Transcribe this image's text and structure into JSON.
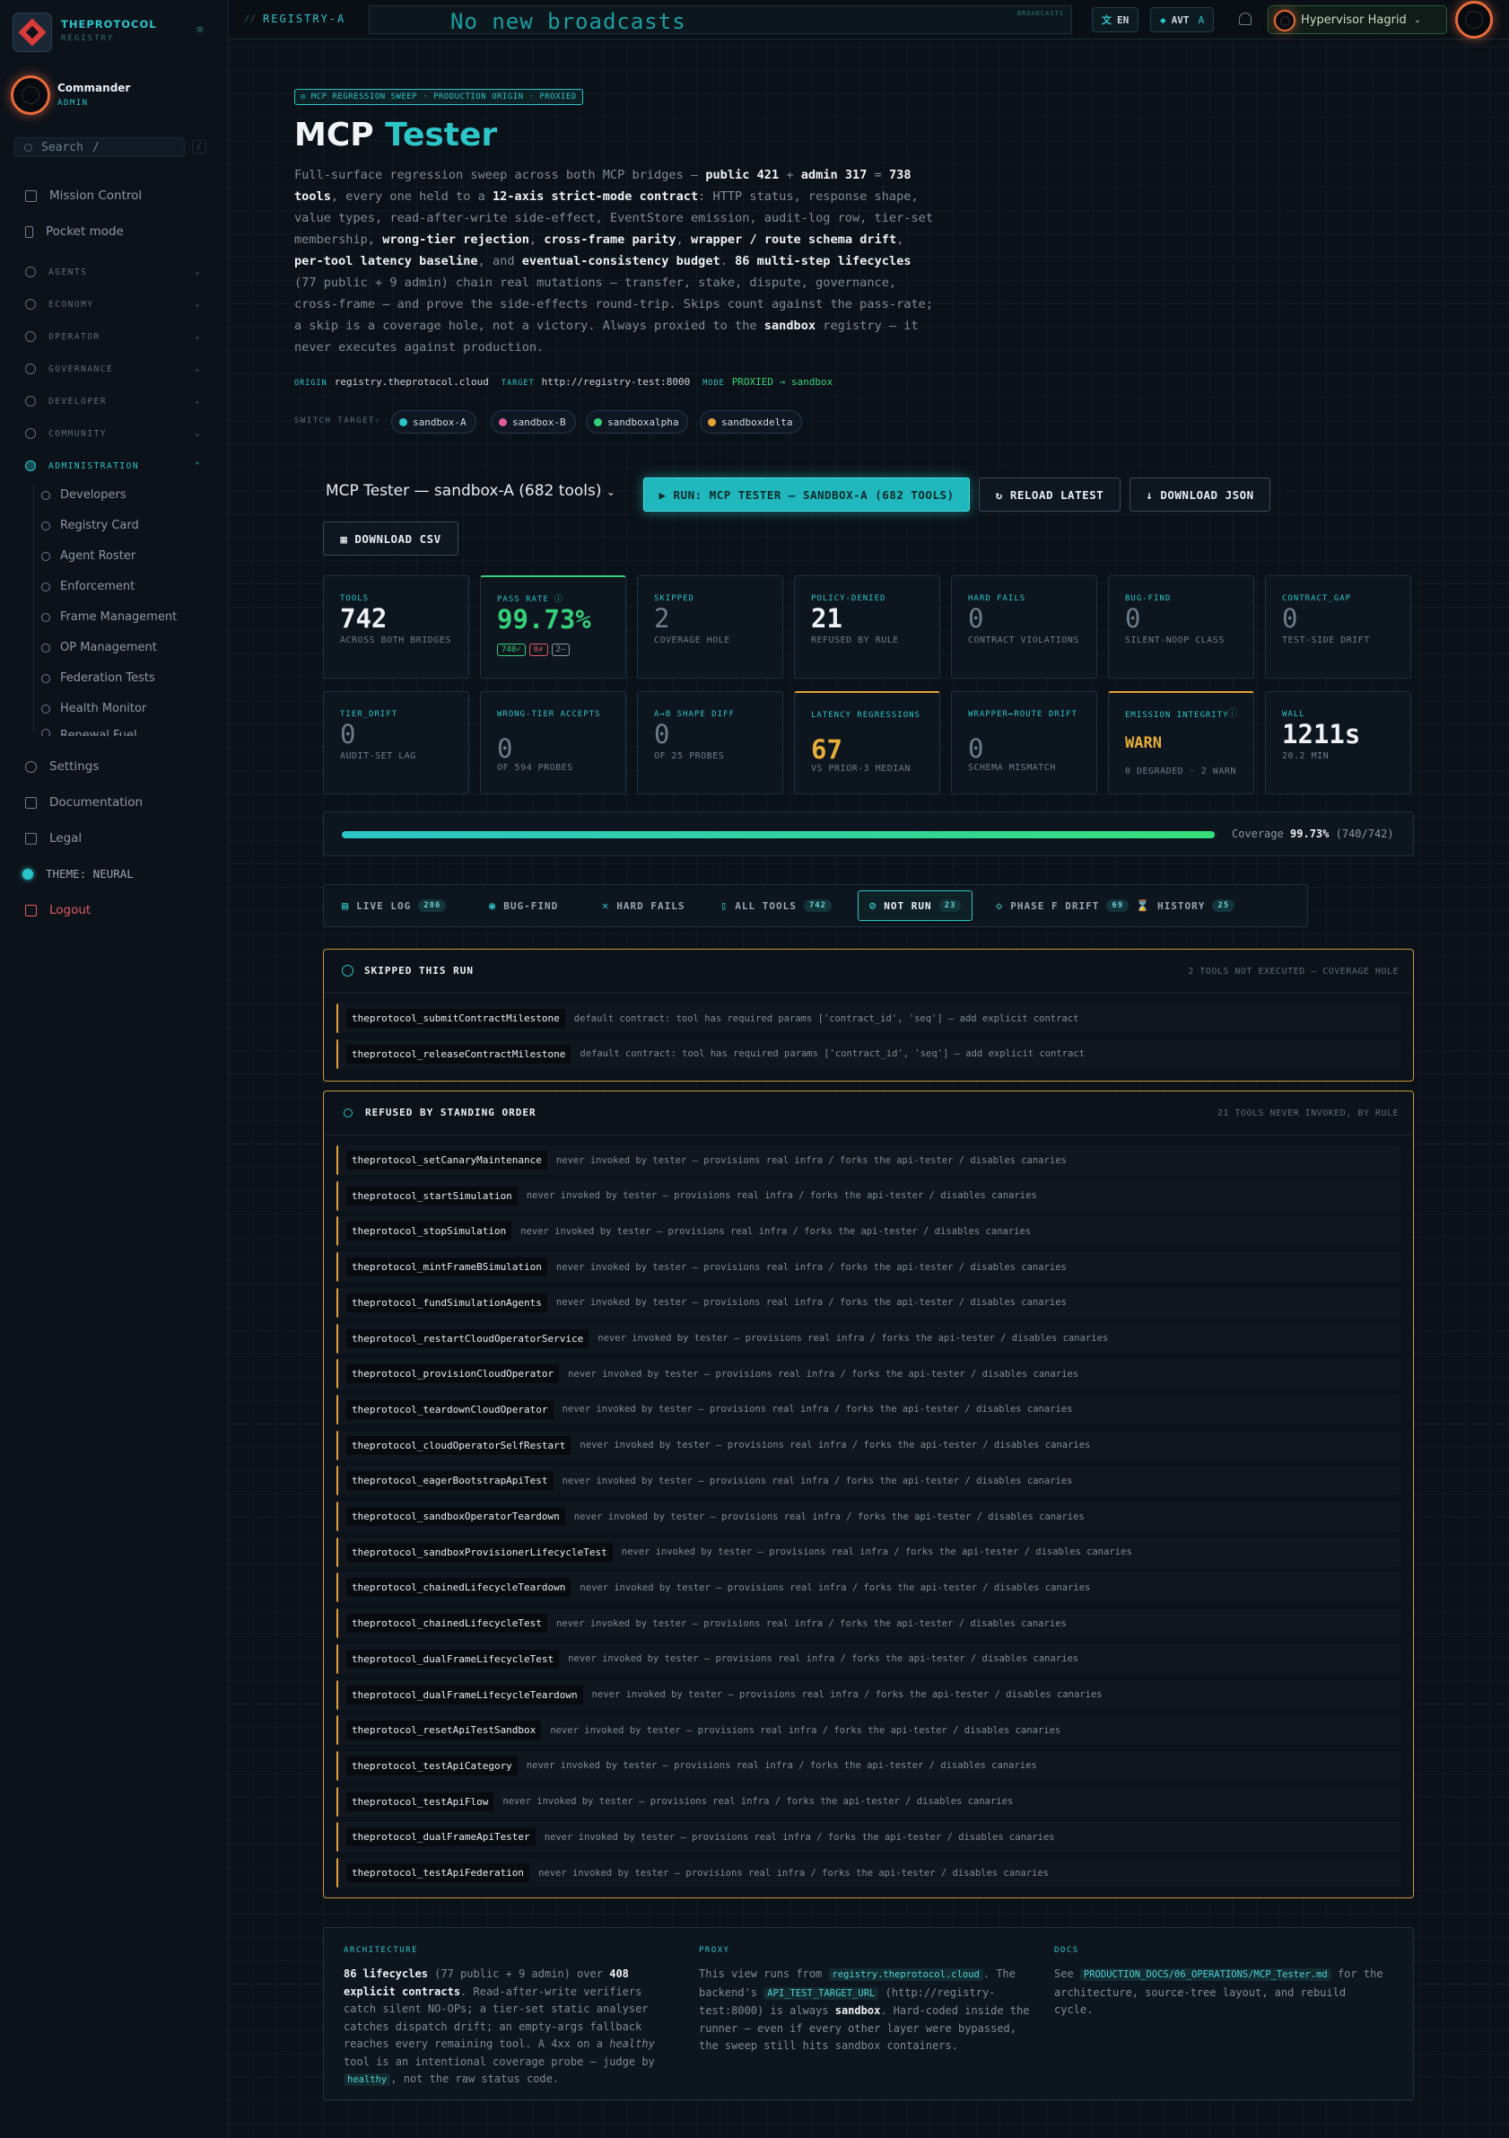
{
  "sidebar": {
    "brand": "THEPROTOCOL",
    "brand_sub": "REGISTRY",
    "user": {
      "name": "Commander",
      "role": "ADMIN"
    },
    "search": {
      "placeholder": "Search",
      "shortcut": "/",
      "key": "/"
    },
    "top_items": [
      "Mission Control",
      "Pocket mode"
    ],
    "sections": [
      "AGENTS",
      "ECONOMY",
      "OPERATOR",
      "GOVERNANCE",
      "DEVELOPER",
      "COMMUNITY"
    ],
    "admin_section": "ADMINISTRATION",
    "admin_items": [
      "Developers",
      "Registry Card",
      "Agent Roster",
      "Enforcement",
      "Frame Management",
      "OP Management",
      "Federation Tests",
      "Health Monitor",
      "Renewal Fuel"
    ],
    "bottom_items": [
      "Settings",
      "Documentation",
      "Legal"
    ],
    "theme": "THEME: NEURAL",
    "logout": "Logout"
  },
  "topbar": {
    "registry": "REGISTRY-A",
    "slashes": "//",
    "ticker": "No new broadcasts",
    "ticker_label": "BROADCASTS",
    "lang": "EN",
    "avt": "AVT",
    "avt_letter": "A",
    "user": "Hypervisor Hagrid"
  },
  "hero": {
    "crumb": "◎ MCP REGRESSION SWEEP · PRODUCTION ORIGIN · PROXIED",
    "title_a": "MCP",
    "title_b": "Tester",
    "lead": [
      {
        "t": "Full-surface regression sweep across both MCP bridges — "
      },
      {
        "b": "public 421"
      },
      {
        "t": " + "
      },
      {
        "b": "admin 317"
      },
      {
        "t": " = "
      },
      {
        "b": "738 tools"
      },
      {
        "t": ", every one held to a "
      },
      {
        "b": "12-axis strict-mode contract"
      },
      {
        "t": ": HTTP status, response shape, value types, read-after-write side-effect, EventStore emission, audit-log row, tier-set membership, "
      },
      {
        "b": "wrong-tier rejection"
      },
      {
        "t": ", "
      },
      {
        "b": "cross-frame parity"
      },
      {
        "t": ", "
      },
      {
        "b": "wrapper / route schema drift"
      },
      {
        "t": ", "
      },
      {
        "b": "per-tool latency baseline"
      },
      {
        "t": ", and "
      },
      {
        "b": "eventual-consistency budget"
      },
      {
        "t": ". "
      },
      {
        "b": "86 multi-step lifecycles"
      },
      {
        "t": " (77 public + 9 admin) chain real mutations — transfer, stake, dispute, governance, cross-frame — and prove the side-effects round-trip. Skips count against the pass-rate; a skip is a coverage hole, not a victory. Always proxied to the "
      },
      {
        "b": "sandbox"
      },
      {
        "t": " registry — it never executes against production."
      }
    ],
    "origin_k": "ORIGIN",
    "origin": "registry.theprotocol.cloud",
    "target_k": "TARGET",
    "target": "http://registry-test:8000",
    "mode_k": "MODE",
    "mode": "PROXIED → sandbox",
    "switch_label": "SWITCH TARGET:",
    "targets": [
      {
        "name": "sandbox-A",
        "color": "#2cc5c8"
      },
      {
        "name": "sandbox-B",
        "color": "#e05aa0"
      },
      {
        "name": "sandboxalpha",
        "color": "#35d07a"
      },
      {
        "name": "sandboxdelta",
        "color": "#e4a338"
      }
    ]
  },
  "controls": {
    "select": "MCP Tester — sandbox-A (682 tools)",
    "run": "▶ RUN: MCP TESTER — SANDBOX-A (682 TOOLS)",
    "reload": "↻ RELOAD LATEST",
    "json": "↓ DOWNLOAD JSON",
    "csv": "▦ DOWNLOAD CSV"
  },
  "stats": [
    {
      "label": "TOOLS",
      "value": "742",
      "sub": "ACROSS BOTH BRIDGES"
    },
    {
      "label": "PASS RATE ⓘ",
      "value": "99.73%",
      "badges": [
        "740✓",
        "0✗",
        "2–"
      ]
    },
    {
      "label": "SKIPPED",
      "value": "2",
      "sub": "COVERAGE HOLE"
    },
    {
      "label": "POLICY-DENIED",
      "value": "21",
      "sub": "REFUSED BY RULE"
    },
    {
      "label": "HARD FAILS",
      "value": "0",
      "sub": "CONTRACT VIOLATIONS"
    },
    {
      "label": "BUG-FIND",
      "value": "0",
      "sub": "SILENT-NOOP CLASS"
    },
    {
      "label": "CONTRACT_GAP",
      "value": "0",
      "sub": "TEST-SIDE DRIFT"
    },
    {
      "label": "TIER_DRIFT",
      "value": "0",
      "sub": "AUDIT-SET LAG"
    },
    {
      "label": "WRONG-TIER ACCEPTS",
      "value": "0",
      "sub": "OF 594 PROBES"
    },
    {
      "label": "A→B SHAPE DIFF",
      "value": "0",
      "sub": "OF 25 PROBES"
    },
    {
      "label": "LATENCY REGRESSIONS",
      "value": "67",
      "sub": "VS PRIOR-3 MEDIAN"
    },
    {
      "label": "WRAPPER↔ROUTE DRIFT",
      "value": "0",
      "sub": "SCHEMA MISMATCH"
    },
    {
      "label": "EMISSION INTEGRITY",
      "value": "WARN",
      "sub": "0 DEGRADED · 2 WARN"
    },
    {
      "label": "WALL",
      "value": "1211s",
      "sub": "20.2 MIN"
    }
  ],
  "coverage": {
    "label": "Coverage",
    "pct": "99.73%",
    "count": "(740/742)",
    "fraction": 0.9973
  },
  "tabs": [
    {
      "icon": "▤",
      "label": "LIVE LOG",
      "count": "286"
    },
    {
      "icon": "◉",
      "label": "BUG-FIND",
      "count": ""
    },
    {
      "icon": "✕",
      "label": "HARD FAILS",
      "count": ""
    },
    {
      "icon": "▯",
      "label": "ALL TOOLS",
      "count": "742"
    },
    {
      "icon": "⊘",
      "label": "NOT RUN",
      "count": "23"
    },
    {
      "icon": "◇",
      "label": "PHASE F DRIFT",
      "count": "69"
    },
    {
      "icon": "⌛",
      "label": "HISTORY",
      "count": "25"
    }
  ],
  "skipped": {
    "title": "SKIPPED THIS RUN",
    "right": "2 TOOLS NOT EXECUTED — COVERAGE HOLE",
    "reason": "default contract: tool has required params ['contract_id', 'seq'] — add explicit contract",
    "tools": [
      "theprotocol_submitContractMilestone",
      "theprotocol_releaseContractMilestone"
    ]
  },
  "refused": {
    "title": "REFUSED BY STANDING ORDER",
    "right": "21 TOOLS NEVER INVOKED, BY RULE",
    "reason": "never invoked by tester — provisions real infra / forks the api-tester / disables canaries",
    "tools": [
      "theprotocol_setCanaryMaintenance",
      "theprotocol_startSimulation",
      "theprotocol_stopSimulation",
      "theprotocol_mintFrameBSimulation",
      "theprotocol_fundSimulationAgents",
      "theprotocol_restartCloudOperatorService",
      "theprotocol_provisionCloudOperator",
      "theprotocol_teardownCloudOperator",
      "theprotocol_cloudOperatorSelfRestart",
      "theprotocol_eagerBootstrapApiTest",
      "theprotocol_sandboxOperatorTeardown",
      "theprotocol_sandboxProvisionerLifecycleTest",
      "theprotocol_chainedLifecycleTeardown",
      "theprotocol_chainedLifecycleTest",
      "theprotocol_dualFrameLifecycleTest",
      "theprotocol_dualFrameLifecycleTeardown",
      "theprotocol_resetApiTestSandbox",
      "theprotocol_testApiCategory",
      "theprotocol_testApiFlow",
      "theprotocol_dualFrameApiTester",
      "theprotocol_testApiFederation"
    ]
  },
  "footer": {
    "arch_label": "ARCHITECTURE",
    "proxy_label": "PROXY",
    "docs_label": "DOCS",
    "arch": [
      {
        "b": "86 lifecycles"
      },
      {
        "t": " (77 public + 9 admin) over "
      },
      {
        "b": "408 explicit contracts"
      },
      {
        "t": ". Read-after-write verifiers catch silent NO-OPs; a tier-set static analyser catches dispatch drift; an empty-args fallback reaches every remaining tool. A 4xx on a "
      },
      {
        "i": "healthy"
      },
      {
        "t": " tool is an intentional coverage probe — judge by "
      },
      {
        "c": "healthy"
      },
      {
        "t": ", not the raw status code."
      }
    ],
    "proxy": [
      {
        "t": "This view runs from "
      },
      {
        "c": "registry.theprotocol.cloud"
      },
      {
        "t": ". The backend's "
      },
      {
        "c": "API_TEST_TARGET_URL"
      },
      {
        "t": " (http://registry-test:8000) is always "
      },
      {
        "b": "sandbox"
      },
      {
        "t": ". Hard-coded inside the runner — even if every other layer were bypassed, the sweep still hits sandbox containers."
      }
    ],
    "docs": [
      {
        "t": "See "
      },
      {
        "c": "PRODUCTION_DOCS/06_OPERATIONS/MCP_Tester.md"
      },
      {
        "t": " for the architecture, source-tree layout, and rebuild cycle."
      }
    ]
  }
}
